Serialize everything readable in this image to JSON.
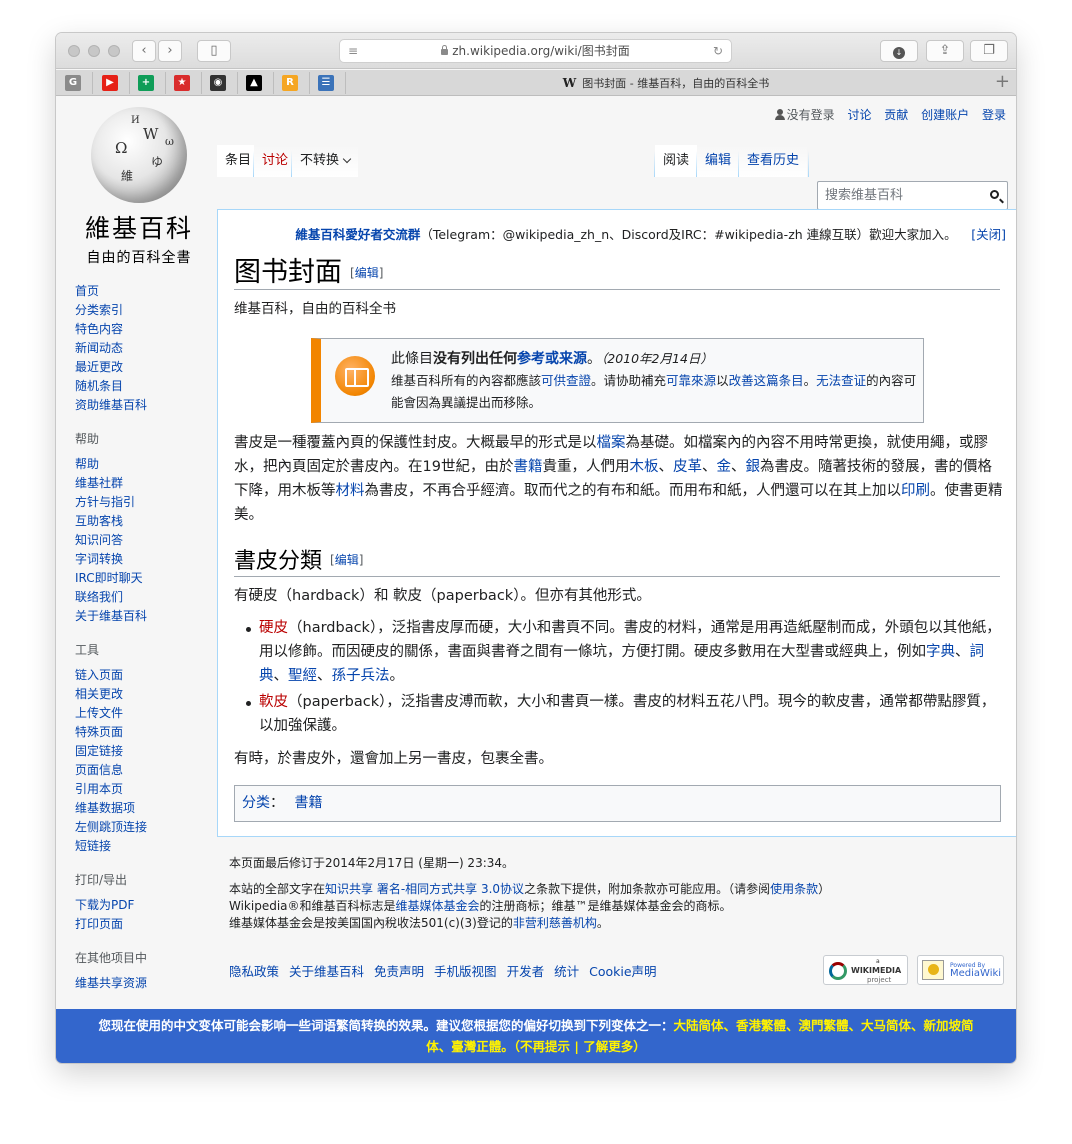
{
  "browser": {
    "url": "zh.wikipedia.org/wiki/图书封面",
    "tab_title": "图书封面 - 维基百科，自由的百科全书",
    "tab_favicon": "W",
    "bookmarks": [
      {
        "icon": "G",
        "color": "#8a8a8a"
      },
      {
        "icon": "▶",
        "color": "#e62117"
      },
      {
        "icon": "+",
        "color": "#0f9d58"
      },
      {
        "icon": "★",
        "color": "#d92c2c"
      },
      {
        "icon": "◉",
        "color": "#333333"
      },
      {
        "icon": "▲",
        "color": "#000000"
      },
      {
        "icon": "R",
        "color": "#f5a623"
      },
      {
        "icon": "☰",
        "color": "#3b73b9"
      }
    ],
    "plus": "+"
  },
  "personal": {
    "not_logged_in": "没有登录",
    "talk": "讨论",
    "contributions": "贡献",
    "create_account": "创建账户",
    "login": "登录"
  },
  "logo": {
    "title": "維基百科",
    "subtitle": "自由的百科全書",
    "glyphs": [
      "W",
      "Ω",
      "維",
      "ゆ",
      "И",
      "ω"
    ]
  },
  "sidebar": {
    "main": [
      "首页",
      "分类索引",
      "特色内容",
      "新闻动态",
      "最近更改",
      "随机条目",
      "资助维基百科"
    ],
    "help_heading": "帮助",
    "help": [
      "帮助",
      "维基社群",
      "方针与指引",
      "互助客栈",
      "知识问答",
      "字词转换",
      "IRC即时聊天",
      "联络我们",
      "关于维基百科"
    ],
    "tools_heading": "工具",
    "tools": [
      "链入页面",
      "相关更改",
      "上传文件",
      "特殊页面",
      "固定链接",
      "页面信息",
      "引用本页",
      "维基数据项",
      "左侧跳顶连接",
      "短链接"
    ],
    "print_heading": "打印/导出",
    "print": [
      "下载为PDF",
      "打印页面"
    ],
    "other_heading": "在其他项目中",
    "other": [
      "维基共享资源"
    ]
  },
  "tabs": {
    "article": "条目",
    "talk": "讨论",
    "variant": "不转换",
    "read": "阅读",
    "edit": "编辑",
    "history": "查看历史",
    "search_placeholder": "搜索维基百科"
  },
  "sitenotice": {
    "link": "維基百科愛好者交流群",
    "text": "（Telegram：@wikipedia_zh_n、Discord及IRC：#wikipedia-zh 連線互联）歡迎大家加入。",
    "close": "[关闭]"
  },
  "article": {
    "title": "图书封面",
    "edit": "编辑",
    "tagline": "维基百科，自由的百科全书",
    "ambox": {
      "title_pre": "此條目",
      "title_bold": "没有列出任何",
      "title_link": "参考或来源",
      "title_end": "。",
      "date": "（2010年2月14日）",
      "body_1": "维基百科所有的內容都應該",
      "body_link1": "可供查證",
      "body_2": "。请协助補充",
      "body_link2": "可靠來源",
      "body_3": "以",
      "body_link3": "改善这篇条目",
      "body_4": "。",
      "body_link4": "无法查证",
      "body_5": "的內容可能會因為異議提出而移除。"
    },
    "para1": {
      "t1": "書皮是一種覆蓋內頁的保護性封皮。大概最早的形式是以",
      "l1": "檔案",
      "t2": "為基礎。如檔案內的內容不用時常更換，就使用繩，或膠水，把內頁固定於書皮內。在19世紀，由於",
      "l2": "書籍",
      "t3": "貴重，人們用",
      "l3": "木板",
      "t4": "、",
      "l4": "皮革",
      "t5": "、",
      "l5": "金",
      "t6": "、",
      "l6": "銀",
      "t7": "為書皮。隨著技術的發展，書的價格下降，用木板等",
      "l7": "材料",
      "t8": "為書皮，不再合乎經濟。取而代之的有布和紙。而用布和紙，人們還可以在其上加以",
      "l8": "印刷",
      "t9": "。使書更精美。"
    },
    "section_title": "書皮分類",
    "section_intro": "有硬皮（hardback）和 軟皮（paperback）。但亦有其他形式。",
    "bullet1": {
      "link": "硬皮",
      "text": "（hardback），泛指書皮厚而硬，大小和書頁不同。書皮的材料，通常是用再造紙壓制而成，外頭包以其他紙，用以修飾。而因硬皮的關係，書面與書脊之間有一條坑，方便打開。硬皮多數用在大型書或經典上，例如",
      "l1": "字典",
      "s1": "、",
      "l2": "詞典",
      "s2": "、",
      "l3": "聖經",
      "s3": "、",
      "l4": "孫子兵法",
      "end": "。"
    },
    "bullet2": {
      "link": "軟皮",
      "text": "（paperback），泛指書皮溥而軟，大小和書頁一樣。書皮的材料五花八門。現今的軟皮書，通常都帶點膠質，以加強保護。"
    },
    "closing": "有時，於書皮外，還會加上另一書皮，包裹全書。",
    "categories_label": "分类",
    "categories": [
      "書籍"
    ]
  },
  "footer": {
    "lastmod": "本页面最后修订于2014年2月17日 (星期一) 23:34。",
    "license_1": "本站的全部文字在",
    "license_link": "知识共享 署名-相同方式共享 3.0协议",
    "license_2": "之条款下提供，附加条款亦可能应用。（请参阅",
    "license_link2": "使用条款",
    "license_3": "）",
    "trademark_1": "Wikipedia®和维基百科标志是",
    "trademark_link": "维基媒体基金会",
    "trademark_2": "的注册商标；维基™是维基媒体基金会的商标。",
    "nonprofit_1": "维基媒体基金会是按美国国內稅收法501(c)(3)登记的",
    "nonprofit_link": "非营利慈善机构",
    "nonprofit_2": "。",
    "links": [
      "隐私政策",
      "关于维基百科",
      "免责声明",
      "手机版视图",
      "开发者",
      "统计",
      "Cookie声明"
    ],
    "badge_wikimedia": "WIKIMEDIA",
    "badge_wikimedia_small": "a",
    "badge_wikimedia_sub": "project",
    "badge_mediawiki_small": "Powered By",
    "badge_mediawiki": "MediaWiki"
  },
  "banner": {
    "text": "您现在使用的中文变体可能会影响一些词语繁简转换的效果。建议您根据您的偏好切换到下列变体之一：",
    "variants": "大陆简体、香港繁體、澳門繁體、大马简体、新加坡简体、臺灣正體",
    "suffix": "。（不再提示 | 了解更多）"
  }
}
